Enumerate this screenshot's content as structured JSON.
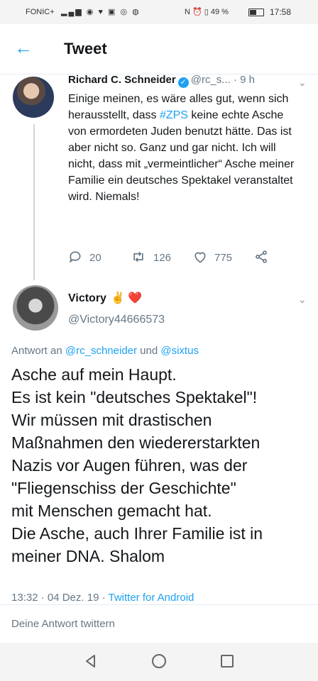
{
  "status_bar": {
    "carrier": "FONIC+",
    "right_icons": "N ⏰ ▯ 49 %",
    "time": "17:58"
  },
  "header": {
    "title": "Tweet"
  },
  "tweet1": {
    "name": "Richard C. Schneider",
    "handle": "@rc_s...",
    "time": "· 9 h",
    "text_before": "Einige meinen, es wäre alles gut, wenn sich herausstellt, dass ",
    "hashtag": "#ZPS",
    "text_after": " keine echte Asche von ermordeten Juden benutzt hätte. Das ist aber nicht so. Ganz und gar nicht. Ich will nicht, dass mit „vermeintlicher“ Asche meiner Familie ein deutsches Spektakel veranstaltet wird. Niemals!",
    "replies": "20",
    "retweets": "126",
    "likes": "775"
  },
  "tweet2": {
    "name": "Victory",
    "name_emoji": "✌️ ❤️",
    "handle": "@Victory44666573",
    "replying_prefix": "Antwort an",
    "replying_user1": "@rc_schneider",
    "replying_conj": "und",
    "replying_user2": "@sixtus",
    "lines": [
      "Asche auf mein Haupt.",
      "Es ist kein \"deutsches Spektakel\"!",
      "Wir müssen mit drastischen",
      "Maßnahmen den wiedererstarkten",
      "Nazis vor Augen führen, was der",
      "\"Fliegenschiss der Geschichte\"",
      "mit Menschen gemacht hat.",
      "Die Asche, auch Ihrer Familie ist in",
      "meiner DNA. Shalom"
    ],
    "timestamp": "13:32 · 04 Dez. 19 ·",
    "source": "Twitter for Android"
  },
  "reply_box": {
    "placeholder": "Deine Antwort twittern"
  },
  "colors": {
    "accent": "#1da1f2",
    "muted": "#657786",
    "heart": "#e0245e"
  }
}
